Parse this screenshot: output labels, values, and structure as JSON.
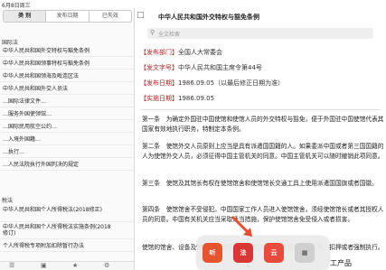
{
  "status_bar": {
    "time": "6月8日周三"
  },
  "left_pane": {
    "tabs": [
      {
        "label": "类 别",
        "active": true
      },
      {
        "label": "发布日期",
        "active": false
      },
      {
        "label": "已失效",
        "active": false
      }
    ],
    "section_1": "国际法",
    "items": [
      {
        "title": "中华人民共和国外交特权与豁免条例",
        "date": ""
      },
      {
        "title": "中华人民共和国领事特权与豁免条例",
        "date": ""
      },
      {
        "title": "中华人民共和国领海及毗连区法",
        "date": ""
      },
      {
        "title": "中华人民共和国外交人员法",
        "date": ""
      },
      {
        "title": "…国际法律文件…",
        "date": ""
      },
      {
        "title": "…服务外国使领馆…",
        "date": ""
      },
      {
        "title": "…国际民用航空公约…",
        "date": ""
      },
      {
        "title": "…入境外国籍…",
        "date": ""
      },
      {
        "title": "…执行…",
        "date": ""
      },
      {
        "title": "…人民法院执行外国判决的规定",
        "date": ""
      }
    ],
    "section_2": "税法",
    "tax_items": [
      {
        "title": "中华人民共和国个人所得税法(2018修正)",
        "date": ""
      },
      {
        "title": "中华人民共和国个人所得税法实施条例(2018修订)",
        "date": ""
      },
      {
        "title": "个人所得税专项附加扣除暂行办法",
        "date": ""
      }
    ],
    "toolbar": [
      "☰",
      "▣",
      "★",
      "⚙"
    ]
  },
  "right_pane": {
    "title": "中华人民共和国外交特权与豁免条例",
    "search_placeholder": "全文检索",
    "meta": [
      {
        "label": "【发布部门】",
        "value": "全国人大常委会"
      },
      {
        "label": "【发文字号】",
        "value": "中华人民共和国主席令第44号"
      },
      {
        "label": "【发布日期】",
        "value": "1986.09.05（以最后修正日期为准）"
      },
      {
        "label": "【实施日期】",
        "value": "1986.09.05"
      }
    ],
    "articles": [
      "第一条　为确定外国驻中国使馆和使馆人员的外交特权与豁免，便于外国驻中国使馆代表其国家有效地执行职务，特制定本条例。",
      "第二条　使馆外交人员原则上应当是具有派遣国国籍的人。如果委派中国或者第三国国籍的人为使馆外交人员，必须征得中国主管机关的同意。中国主管机关可以随时撤销此项同意。",
      "第三条　使馆及其馆长有权在使馆馆舍和使馆馆长交通工具上使用派遣国国旗或者国徽。",
      "第四条　使馆馆舍不受侵犯。中国国家工作人员进入使馆馆舍，须经使馆馆长或者其授权人员的同意。中国有关机关应当采取适当措施，保护使馆馆舍免受侵入或者损害。",
      "使馆的馆舍、设备及馆舍内其他财产和使馆交通工具免受搜查、征用、扣押或者强制执行。"
    ]
  },
  "dock": {
    "apps": [
      "听",
      "法",
      "云",
      "▦"
    ]
  },
  "overflow_text": "工产品"
}
